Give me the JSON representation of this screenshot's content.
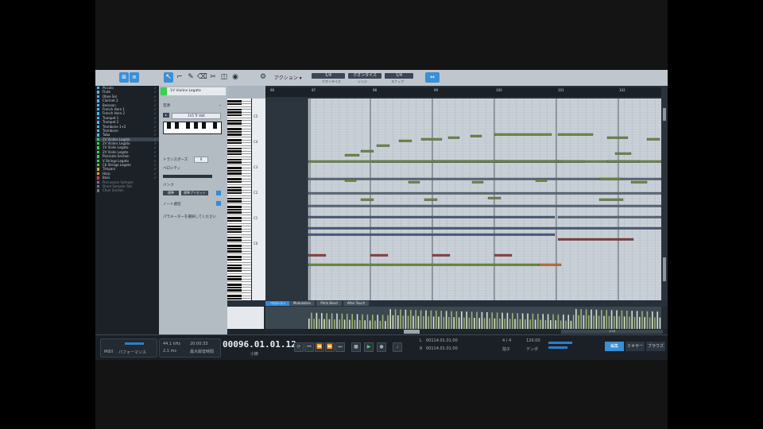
{
  "toolbar": {
    "action_label": "アクション ▾",
    "chip_1": "1/4",
    "chip_1_sub": "クオンタイズ",
    "chip_2": "クオンタイズ",
    "chip_2_sub": "レンジ",
    "chip_3": "1/4",
    "chip_3_sub": "スナップ"
  },
  "tracks": [
    {
      "name": "Piccolo",
      "color": "#48b9f0"
    },
    {
      "name": "Flute",
      "color": "#48b9f0"
    },
    {
      "name": "Oboe Sol",
      "color": "#48b9f0"
    },
    {
      "name": "Clarinet 2",
      "color": "#48b9f0"
    },
    {
      "name": "Bassoon",
      "color": "#48b9f0"
    },
    {
      "name": "French Horn 1",
      "color": "#48b9f0"
    },
    {
      "name": "French Horn 2",
      "color": "#48b9f0"
    },
    {
      "name": "Trumpet 1",
      "color": "#48b9f0"
    },
    {
      "name": "Trumpet 2",
      "color": "#48b9f0"
    },
    {
      "name": "Trombone 1+2",
      "color": "#48b9f0"
    },
    {
      "name": "Trombone",
      "color": "#48b9f0"
    },
    {
      "name": "Tuba",
      "color": "#48b9f0"
    },
    {
      "name": "1V Violins Legato",
      "color": "#39d24a"
    },
    {
      "name": "2V Violins Legato",
      "color": "#39d24a"
    },
    {
      "name": "1V Violin Legato",
      "color": "#39d24a"
    },
    {
      "name": "2V Violin Legato",
      "color": "#39d24a"
    },
    {
      "name": "Pizzicato Section",
      "color": "#39d24a"
    },
    {
      "name": "V Strings Legato",
      "color": "#39d24a"
    },
    {
      "name": "Cb Strings Legato",
      "color": "#39d24a"
    },
    {
      "name": "Timpani",
      "color": "#e0a23a"
    },
    {
      "name": "Harp",
      "color": "#e0a23a"
    },
    {
      "name": "Bass",
      "color": "#e03a3a"
    },
    {
      "name": "Percussion Sampler",
      "color": "#6c7580"
    },
    {
      "name": "Drum Sampler Set",
      "color": "#6c7580"
    },
    {
      "name": "Choir Section",
      "color": "#6c7580"
    }
  ],
  "inspector": {
    "track_title": "1V Violins Legato",
    "label_instrument": "音源",
    "field_instrument": "1V1 Tr Volt",
    "label_transpose": "トランスポーズ",
    "field_transpose": "0",
    "label_velocity": "ベロシティ",
    "label_bank": "バンク",
    "field_bank": "標準",
    "field_preset": "標準プリセット",
    "label_delay": "ノート遅延",
    "hint": "パラメーターを選択してください"
  },
  "ruler": {
    "bars": [
      "96",
      "97",
      "98",
      "99",
      "100",
      "101",
      "102"
    ]
  },
  "keyboard": {
    "octave_labels": [
      "C5",
      "C4",
      "C3",
      "C2",
      "C1",
      "C0"
    ]
  },
  "editor_tabs": [
    "ベロシティ",
    "Modulation",
    "Pitch Bend",
    "After Touch"
  ],
  "zoom_label": "1/16",
  "transport": {
    "sample_rate": "44.1 kHz",
    "latency": "2.1 ms",
    "time_a": "20:00:33",
    "time_b": "最大録音時間",
    "position": "00096.01.01.12",
    "position_unit": "小節",
    "loop_start": "00114.01.01.00",
    "loop_end": "00114.01.01.00",
    "meter": "4 / 4",
    "tempo": "120.00",
    "key_label": "拍子",
    "tempo_label": "テンポ",
    "left_label": "L",
    "right_label": "R",
    "midi_label": "MIDI",
    "perf_label": "パフォーマンス",
    "tab_edit": "編集",
    "tab_mix": "ミキサー",
    "tab_browse": "ブラウズ"
  }
}
